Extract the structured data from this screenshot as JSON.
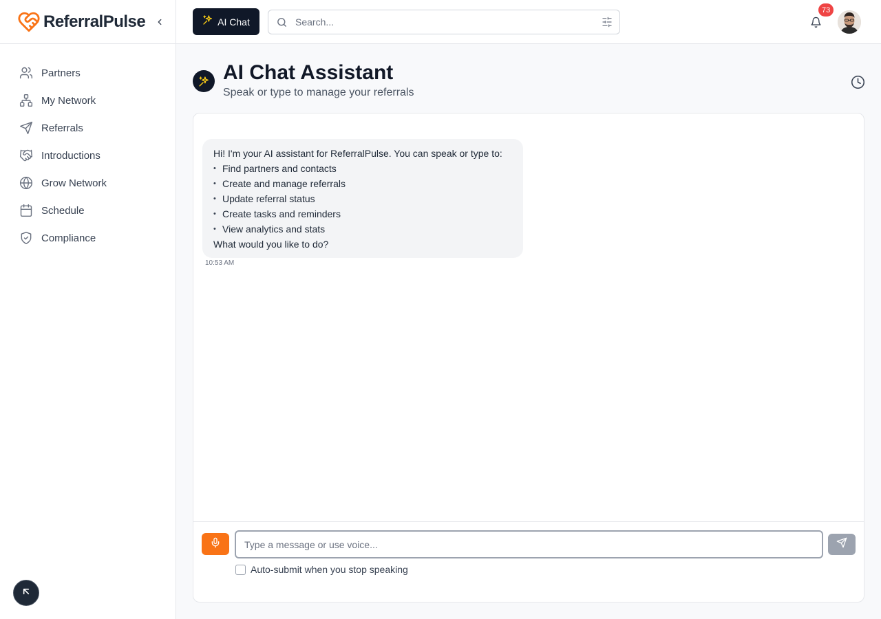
{
  "brand": {
    "name": "ReferralPulse",
    "logo_icon": "heart-handshake-icon",
    "accent_color": "#f97316"
  },
  "sidebar": {
    "collapse_icon": "chevron-left-icon",
    "items": [
      {
        "label": "Partners",
        "icon": "users-icon"
      },
      {
        "label": "My Network",
        "icon": "network-icon"
      },
      {
        "label": "Referrals",
        "icon": "send-icon"
      },
      {
        "label": "Introductions",
        "icon": "handshake-icon"
      },
      {
        "label": "Grow Network",
        "icon": "globe-icon"
      },
      {
        "label": "Schedule",
        "icon": "calendar-icon"
      },
      {
        "label": "Compliance",
        "icon": "shield-check-icon"
      }
    ]
  },
  "topbar": {
    "ai_chat_label": "AI Chat",
    "search_placeholder": "Search...",
    "notification_count": "73",
    "badge_color": "#ef4444"
  },
  "header": {
    "title": "AI Chat Assistant",
    "subtitle": "Speak or type to manage your referrals"
  },
  "chat": {
    "messages": [
      {
        "sender": "assistant",
        "intro": "Hi! I'm your AI assistant for ReferralPulse. You can speak or type to:",
        "bullets": [
          "Find partners and contacts",
          "Create and manage referrals",
          "Update referral status",
          "Create tasks and reminders",
          "View analytics and stats"
        ],
        "outro": "What would you like to do?",
        "time": "10:53 AM"
      }
    ],
    "input_placeholder": "Type a message or use voice...",
    "auto_submit_label": "Auto-submit when you stop speaking",
    "auto_submit_checked": false
  }
}
